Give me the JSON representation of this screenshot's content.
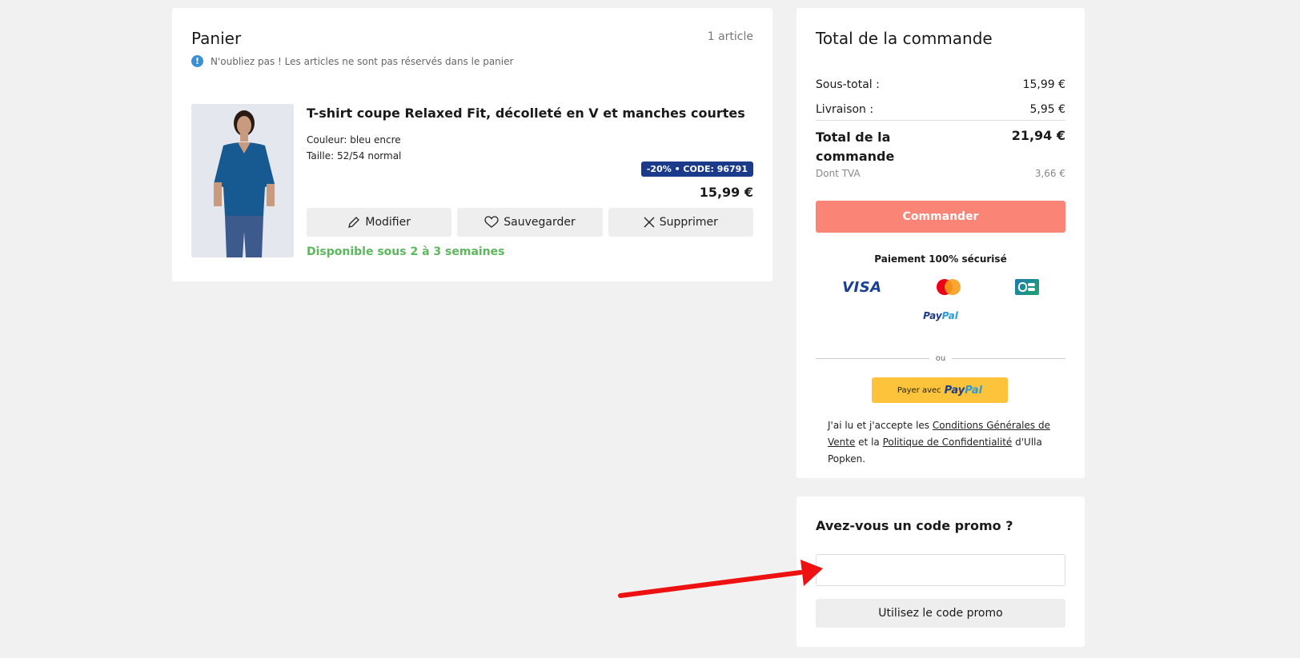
{
  "cart": {
    "title": "Panier",
    "item_count": "1 article",
    "notice": "N'oubliez pas ! Les articles ne sont pas réservés dans le panier",
    "item": {
      "name": "T-shirt coupe Relaxed Fit, décolleté en V et manches courtes",
      "color": "Couleur: bleu encre",
      "size": "Taille: 52/54 normal",
      "badge": "-20% • CODE: 96791",
      "price": "15,99 €",
      "availability": "Disponible sous 2 à 3 semaines"
    },
    "actions": {
      "edit": "Modifier",
      "save": "Sauvegarder",
      "delete": "Supprimer"
    }
  },
  "order": {
    "title": "Total de la commande",
    "subtotal_label": "Sous-total :",
    "subtotal_value": "15,99 €",
    "shipping_label": "Livraison :",
    "shipping_value": "5,95 €",
    "total_label": "Total de la commande",
    "total_value": "21,94 €",
    "tax_label": "Dont TVA",
    "tax_value": "3,66 €",
    "checkout_button": "Commander",
    "secure_text": "Paiement 100% sécurisé",
    "payment_methods": [
      "VISA",
      "Mastercard",
      "CB",
      "PayPal"
    ],
    "visa_text": "VISA",
    "paypal_pay": "Pay",
    "paypal_pal": "Pal",
    "or_text": "ou",
    "paypal_button_prefix": "Payer avec",
    "terms": {
      "part1": "J'ai lu et j'accepte les ",
      "cgv_link": "Conditions Générales de Vente",
      "part2": " et la ",
      "privacy_link": "Politique de Confidentialité",
      "part3": " d'Ulla Popken."
    }
  },
  "promo": {
    "title": "Avez-vous un code promo ?",
    "input_value": "",
    "button": "Utilisez le code promo"
  },
  "colors": {
    "background": "#f1f1f1",
    "checkout_button": "#fa8577",
    "badge": "#1b3a8a",
    "availability": "#5cb85c",
    "paypal_button": "#fdc33a",
    "annotation_arrow": "#ee1111"
  }
}
